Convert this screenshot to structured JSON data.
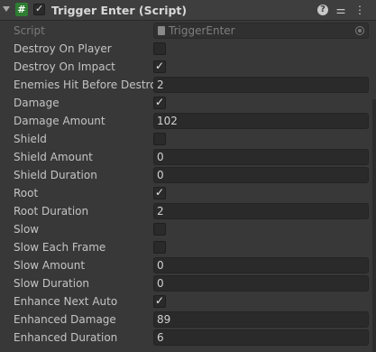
{
  "component": {
    "title": "Trigger Enter (Script)",
    "enabled": true,
    "icons": {
      "script": "#",
      "help": "?",
      "presets": "⚌",
      "menu": "⋮"
    }
  },
  "script_field": {
    "label": "Script",
    "value": "TriggerEnter"
  },
  "fields": [
    {
      "label": "Destroy On Player",
      "type": "checkbox",
      "checked": false
    },
    {
      "label": "Destroy On Impact",
      "type": "checkbox",
      "checked": true
    },
    {
      "label": "Enemies Hit Before Destroy",
      "type": "number",
      "value": "2"
    },
    {
      "label": "Damage",
      "type": "checkbox",
      "checked": true
    },
    {
      "label": "Damage Amount",
      "type": "number",
      "value": "102"
    },
    {
      "label": "Shield",
      "type": "checkbox",
      "checked": false
    },
    {
      "label": "Shield Amount",
      "type": "number",
      "value": "0"
    },
    {
      "label": "Shield Duration",
      "type": "number",
      "value": "0"
    },
    {
      "label": "Root",
      "type": "checkbox",
      "checked": true
    },
    {
      "label": "Root Duration",
      "type": "number",
      "value": "2"
    },
    {
      "label": "Slow",
      "type": "checkbox",
      "checked": false
    },
    {
      "label": "Slow Each Frame",
      "type": "checkbox",
      "checked": false
    },
    {
      "label": "Slow Amount",
      "type": "number",
      "value": "0"
    },
    {
      "label": "Slow Duration",
      "type": "number",
      "value": "0"
    },
    {
      "label": "Enhance Next Auto",
      "type": "checkbox",
      "checked": true
    },
    {
      "label": "Enhanced Damage",
      "type": "number",
      "value": "89"
    },
    {
      "label": "Enhanced Duration",
      "type": "number",
      "value": "6"
    }
  ]
}
